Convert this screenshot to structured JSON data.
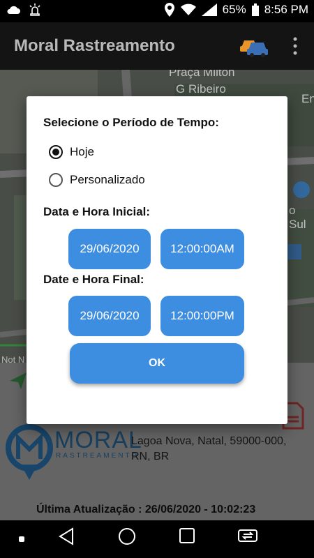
{
  "status_bar": {
    "icons_left": [
      "cloud-icon",
      "alarm-icon"
    ],
    "battery_percent": "65%",
    "time": "8:56 PM",
    "icons_right": [
      "location-icon",
      "wifi-icon",
      "signal-icon",
      "battery-icon"
    ]
  },
  "app_bar": {
    "title": "Moral Rastreamento",
    "actions": [
      "car-icon",
      "more-vert-icon"
    ]
  },
  "map": {
    "labels": [
      "Praça Milton",
      "G Ribeiro",
      "En",
      "o Sul",
      "Not N"
    ]
  },
  "vehicle_panel": {
    "brand": "MORAL",
    "brand_sub": "RASTREAMENTO",
    "address_partial": "Lagoa Nova, Natal, 59000-000,",
    "address_line2": "RN, BR",
    "last_update": "Última Atualização : 26/06/2020 - 10:02:23"
  },
  "dialog": {
    "heading": "Selecione o Período de Tempo:",
    "options": [
      {
        "label": "Hoje",
        "checked": true
      },
      {
        "label": "Personalizado",
        "checked": false
      }
    ],
    "start_label": "Data e Hora Inicial:",
    "start_date": "29/06/2020",
    "start_time": "12:00:00AM",
    "end_label": "Date e Hora Final:",
    "end_date": "29/06/2020",
    "end_time": "12:00:00PM",
    "ok_label": "OK"
  },
  "colors": {
    "accent": "#3d8de0",
    "app_bar": "#141414",
    "scrim_panel": "#7a7a7a"
  }
}
